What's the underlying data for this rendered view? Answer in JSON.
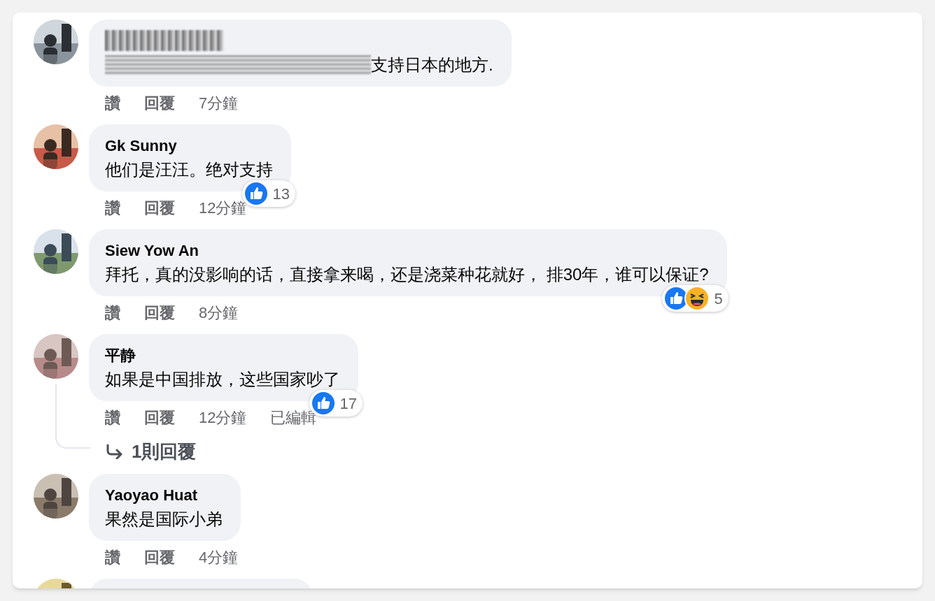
{
  "comments": [
    {
      "redacted": true,
      "text": "支持日本的地方.",
      "actions": [
        "讚",
        "回覆",
        "7分鐘"
      ]
    },
    {
      "name": "Gk Sunny",
      "text": "他们是汪汪。绝对支持",
      "actions": [
        "讚",
        "回覆",
        "12分鐘"
      ],
      "reactions": [
        {
          "kind": "like"
        }
      ],
      "reaction_count": "13"
    },
    {
      "name": "Siew Yow An",
      "text": "拜托，真的没影响的话，直接拿来喝，还是浇菜种花就好， 排30年，谁可以保证?",
      "actions": [
        "讚",
        "回覆",
        "8分鐘"
      ],
      "reactions": [
        {
          "kind": "like"
        },
        {
          "kind": "haha"
        }
      ],
      "reaction_count": "5"
    },
    {
      "name": "平静",
      "text": "如果是中国排放，这些国家吵了",
      "actions": [
        "讚",
        "回覆",
        "12分鐘",
        "已編輯"
      ],
      "reactions": [
        {
          "kind": "like"
        }
      ],
      "reaction_count": "17",
      "replies_link": "1則回覆"
    },
    {
      "name": "Yaoyao Huat",
      "text": "果然是国际小弟",
      "actions": [
        "讚",
        "回覆",
        "4分鐘"
      ]
    }
  ],
  "more_below": true
}
